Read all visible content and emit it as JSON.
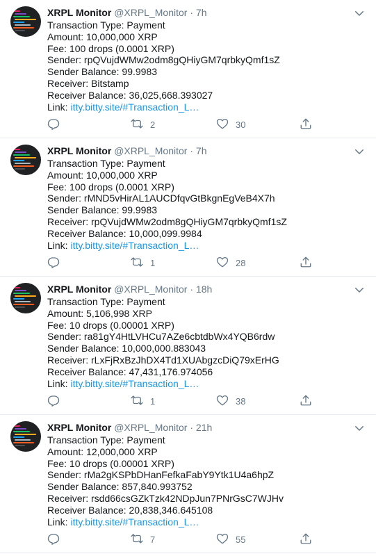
{
  "tweets": [
    {
      "name": "XRPL Monitor",
      "handle": "@XRPL_Monitor",
      "sep": "·",
      "time": "7h",
      "lines": [
        "Transaction Type: Payment",
        "Amount: 10,000,000 XRP",
        "Fee: 100 drops (0.0001 XRP)",
        "Sender: rpQVujdWMw2odm8gQHiyGM7qrbkyQmf1sZ",
        "Sender Balance: 99.9983",
        "Receiver: Bitstamp",
        "Receiver Balance: 36,025,668.393027"
      ],
      "link_prefix": "Link: ",
      "link_text": "itty.bitty.site/#Transaction_L…",
      "retweets": "2",
      "likes": "30"
    },
    {
      "name": "XRPL Monitor",
      "handle": "@XRPL_Monitor",
      "sep": "·",
      "time": "7h",
      "lines": [
        "Transaction Type: Payment",
        "Amount: 10,000,000 XRP",
        "Fee: 100 drops (0.0001 XRP)",
        "Sender: rMND5vHirAL1AUCDfqvGtBkgnEgVeB4X7h",
        "Sender Balance: 99.9983",
        "Receiver: rpQVujdWMw2odm8gQHiyGM7qrbkyQmf1sZ",
        "Receiver Balance: 10,000,099.9984"
      ],
      "link_prefix": "Link: ",
      "link_text": "itty.bitty.site/#Transaction_L…",
      "retweets": "1",
      "likes": "28"
    },
    {
      "name": "XRPL Monitor",
      "handle": "@XRPL_Monitor",
      "sep": "·",
      "time": "18h",
      "lines": [
        "Transaction Type: Payment",
        "Amount: 5,106,998 XRP",
        "Fee: 10 drops (0.00001 XRP)",
        "Sender: ra81gY4HtLVHCu7AZe6cbtdbWx4YQB6rdw",
        "Sender Balance: 10,000,000.883043",
        "Receiver: rLxFjRxBzJhDX4Td1XUAbgzcDiQ79xErHG",
        "Receiver Balance: 47,431,176.974056"
      ],
      "link_prefix": "Link: ",
      "link_text": "itty.bitty.site/#Transaction_L…",
      "retweets": "1",
      "likes": "38"
    },
    {
      "name": "XRPL Monitor",
      "handle": "@XRPL_Monitor",
      "sep": "·",
      "time": "21h",
      "lines": [
        "Transaction Type: Payment",
        "Amount: 12,000,000 XRP",
        "Fee: 10 drops (0.00001 XRP)",
        "Sender: rMa2gKSPbDHanFefkaFabY9Ytk1U4a6hpZ",
        "Sender Balance: 857,840.993752",
        "Receiver: rsdd66csGZkTzk42NDpJun7PNrGsC7WJHv",
        "Receiver Balance: 20,838,346.645108"
      ],
      "link_prefix": "Link: ",
      "link_text": "itty.bitty.site/#Transaction_L…",
      "retweets": "7",
      "likes": "55"
    }
  ],
  "icons": {
    "reply": "reply-icon",
    "retweet": "retweet-icon",
    "like": "heart-icon",
    "share": "share-icon",
    "caret": "chevron-down-icon"
  },
  "colors": {
    "name": "#14171a",
    "muted": "#657786",
    "link": "#1b95e0",
    "divider": "#e6ecf0"
  }
}
